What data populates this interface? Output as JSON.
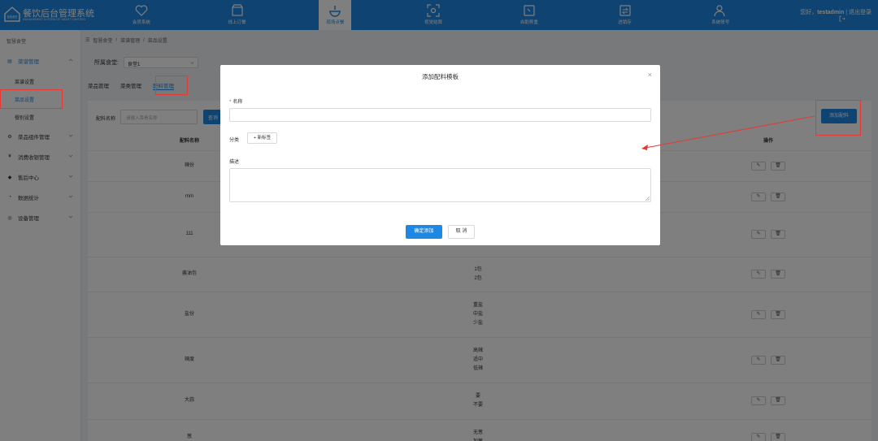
{
  "app": {
    "title": "餐饮后台管理系统",
    "subtitle": "MANAGEMENT SYSTEM OF SMART CANTEEN",
    "logo_text": "智慧食堂"
  },
  "nav": [
    {
      "label": "会员系统",
      "icon": "heart-icon"
    },
    {
      "label": "线上订餐",
      "icon": "store-icon"
    },
    {
      "label": "现场点餐",
      "icon": "dish-icon",
      "active": true
    },
    {
      "label": "视觉结算",
      "icon": "scan-icon"
    },
    {
      "label": "自助称重",
      "icon": "scale-icon"
    },
    {
      "label": "进销存",
      "icon": "exchange-icon"
    },
    {
      "label": "系统账号",
      "icon": "users-icon"
    }
  ],
  "user": {
    "greeting": "您好，",
    "name": "testadmin",
    "divider": "|",
    "logout": "退出登录"
  },
  "sidebar": {
    "title": "智慧食堂",
    "menus": [
      {
        "label": "菜谱管理",
        "icon": "menu-icon",
        "active": true
      },
      {
        "label": "菜品组件管理",
        "icon": "gear-icon"
      },
      {
        "label": "消费收银管理",
        "icon": "cashier-icon"
      },
      {
        "label": "售后中心",
        "icon": "service-icon"
      },
      {
        "label": "数据统计",
        "icon": "chart-icon"
      },
      {
        "label": "设备管理",
        "icon": "device-icon"
      }
    ],
    "sub_items": [
      {
        "label": "菜谱设置"
      },
      {
        "label": "菜品设置",
        "active": true
      },
      {
        "label": "餐别设置"
      }
    ]
  },
  "breadcrumb": [
    "智慧食堂",
    "/",
    "菜谱管理",
    "/",
    "菜品设置"
  ],
  "canteen": {
    "label": "所属食堂:",
    "value": "食堂1"
  },
  "tabs": [
    {
      "label": "菜品管理"
    },
    {
      "label": "菜类管理"
    },
    {
      "label": "配料管理",
      "active": true
    }
  ],
  "filter": {
    "label": "配料名称",
    "placeholder": "请输入菜肴名称",
    "query": "查询"
  },
  "add_button": "添加配料",
  "table": {
    "headers": [
      "配料名称",
      "",
      "操作"
    ],
    "rows": [
      {
        "name": "辣份",
        "options": []
      },
      {
        "name": "mm",
        "options": []
      },
      {
        "name": "111",
        "options": []
      },
      {
        "name": "酱油包",
        "options": [
          "1包",
          "2包"
        ]
      },
      {
        "name": "盐份",
        "options": [
          "重盐",
          "中盐",
          "少盐"
        ]
      },
      {
        "name": "辣度",
        "options": [
          "高辣",
          "适中",
          "低辣"
        ]
      },
      {
        "name": "大蒜",
        "options": [
          "要",
          "不要"
        ]
      },
      {
        "name": "葱",
        "options": [
          "无葱",
          "加葱"
        ]
      }
    ]
  },
  "modal": {
    "title": "添加配料模板",
    "close": "×",
    "name_label": "名称",
    "required_mark": "*",
    "category_label": "分类",
    "add_tag": "+ 新标签",
    "desc_label": "描述",
    "confirm": "确定添加",
    "cancel": "取 消"
  },
  "colors": {
    "primary": "#1e88e5",
    "annotation": "#e53935"
  }
}
